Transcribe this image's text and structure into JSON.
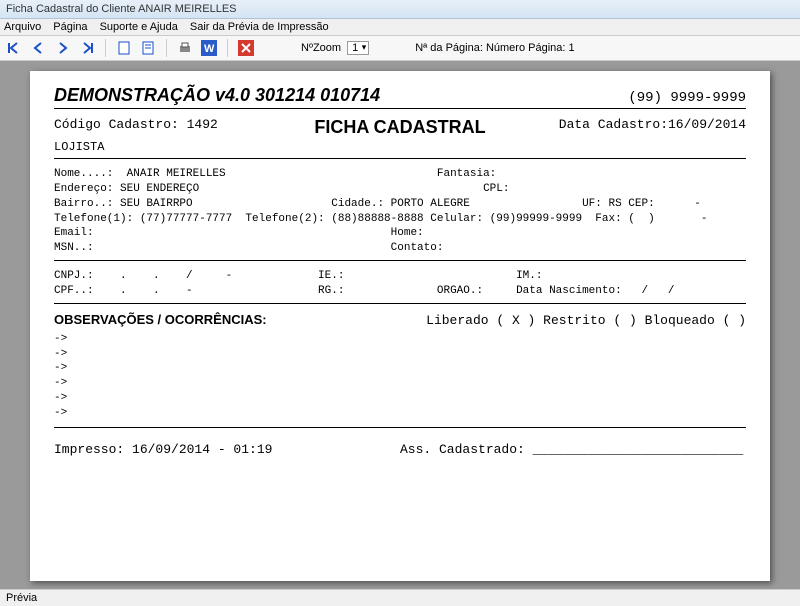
{
  "window": {
    "title": "Ficha Cadastral do Cliente  ANAIR MEIRELLES"
  },
  "menu": {
    "arquivo": "Arquivo",
    "pagina": "Página",
    "suporte": "Suporte e Ajuda",
    "sair": "Sair da Prévia de Impressão"
  },
  "toolbar": {
    "zoom_label": "NºZoom",
    "zoom_value": "1",
    "page_label": "Nª da Página: Número Página: 1"
  },
  "doc": {
    "demo_title": "DEMONSTRAÇÃO v4.0 301214 010714",
    "phone": "(99) 9999-9999",
    "codigo_label": "Código Cadastro:  1492",
    "ficha_title": "FICHA CADASTRAL",
    "data_cad": "Data Cadastro:16/09/2014",
    "lojista": "LOJISTA",
    "l1": "Nome....:  ANAIR MEIRELLES                                Fantasia:",
    "l2": "Endereço: SEU ENDEREÇO                                           CPL:",
    "l3": "Bairro..: SEU BAIRRPO                     Cidade.: PORTO ALEGRE                 UF: RS CEP:      -",
    "l4": "Telefone(1): (77)77777-7777  Telefone(2): (88)88888-8888 Celular: (99)99999-9999  Fax: (  )       -",
    "l5": "Email:                                             Home:",
    "l6": "MSN..:                                             Contato:",
    "l7": "CNPJ.:    .    .    /     -             IE.:                          IM.:",
    "l8": "CPF..:    .    .    -                   RG.:              ORGAO.:     Data Nascimento:   /   /",
    "obs_title": "OBSERVAÇÕES / OCORRÊNCIAS:",
    "obs_status": "Liberado (  X  )      Restrito (    )     Bloqueado (    )",
    "arrow": "->",
    "impresso": "Impresso: 16/09/2014 - 01:19",
    "ass": "Ass. Cadastrado: ___________________________"
  },
  "status": {
    "text": "Prévia"
  }
}
